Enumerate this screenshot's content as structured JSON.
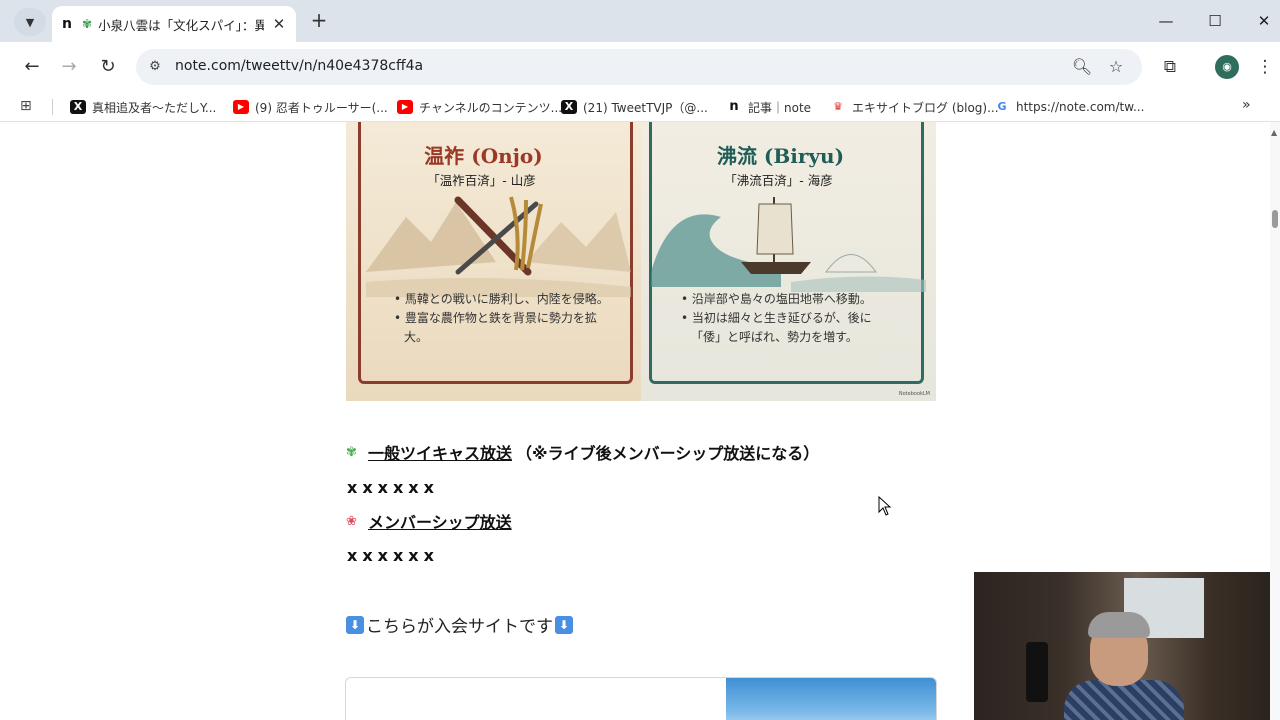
{
  "browser": {
    "tab": {
      "favicon": "n",
      "icon": "clover-icon",
      "title": "小泉八雲は「文化スパイ」：異",
      "close": "✕"
    },
    "new_tab": "+",
    "window_controls": {
      "minimize": "—",
      "maximize": "☐",
      "close": "✕"
    },
    "toolbar": {
      "back": "←",
      "forward": "→",
      "reload": "↻",
      "url": "note.com/tweettv/n/n40e4378cff4a"
    },
    "bookmarks": [
      {
        "icon": "x-icon",
        "glyph": "X",
        "label": "真相追及者〜ただしY..."
      },
      {
        "icon": "youtube-icon",
        "glyph": "▶",
        "label": "(9) 忍者トゥルーサー(..."
      },
      {
        "icon": "youtube-icon",
        "glyph": "▶",
        "label": "チャンネルのコンテンツ..."
      },
      {
        "icon": "x-icon",
        "glyph": "X",
        "label": "(21) TweetTVJP（@..."
      },
      {
        "icon": "note-icon",
        "glyph": "n",
        "label": "記事｜note"
      },
      {
        "icon": "excite-icon",
        "glyph": "♛",
        "label": "エキサイトブログ (blog)..."
      },
      {
        "icon": "google-icon",
        "glyph": "G",
        "label": "https://note.com/tw..."
      }
    ],
    "bookmarks_more": "»"
  },
  "article": {
    "image": {
      "left": {
        "title": "温祚 (Onjo)",
        "subtitle": "「温祚百済」- 山彦",
        "bullets": [
          "• 馬韓との戦いに勝利し、内陸を侵略。",
          "• 豊富な農作物と鉄を背景に勢力を拡大。"
        ]
      },
      "right": {
        "title": "沸流 (Biryu)",
        "subtitle": "「沸流百済」- 海彦",
        "bullets": [
          "• 沿岸部や島々の塩田地帯へ移動。",
          "• 当初は細々と生き延びるが、後に「倭」と呼ばれ、勢力を増す。"
        ]
      },
      "credit": "NotebookLM"
    },
    "section1": {
      "icon": "clover-icon",
      "link": "一般ツイキャス放送",
      "note": "（※ライブ後メンバーシップ放送になる）",
      "placeholder": "xxxxxx"
    },
    "section2": {
      "icon": "maple-leaf-icon",
      "link": "メンバーシップ放送",
      "placeholder": "xxxxxx"
    },
    "join": {
      "text": "こちらが入会サイトです",
      "arrow": "⬇"
    }
  }
}
